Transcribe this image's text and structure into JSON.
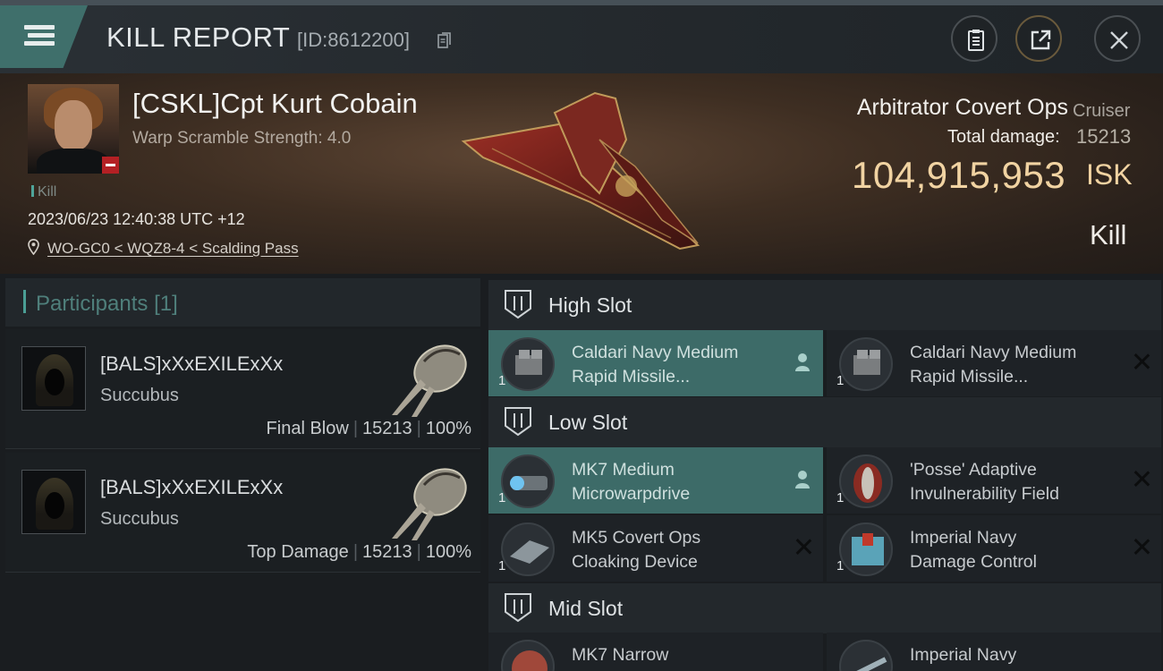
{
  "header": {
    "title": "KILL REPORT",
    "report_id": "[ID:8612200]"
  },
  "victim": {
    "name": "[CSKL]Cpt Kurt Cobain",
    "warp_scramble": "Warp Scramble Strength: 4.0",
    "kill_tag": "Kill",
    "datetime": "2023/06/23 12:40:38 UTC +12",
    "location": "WO-GC0 < WQZ8-4 < Scalding Pass"
  },
  "ship": {
    "name": "Arbitrator Covert Ops",
    "class": "Cruiser",
    "damage_label": "Total damage:",
    "damage_value": "15213",
    "isk_value": "104,915,953",
    "isk_unit": "ISK",
    "result": "Kill"
  },
  "participants": {
    "title": "Participants",
    "count": "[1]",
    "cards": [
      {
        "name": "[BALS]xXxEXILExXx",
        "ship": "Succubus",
        "role": "Final Blow",
        "damage": "15213",
        "percent": "100%"
      },
      {
        "name": "[BALS]xXxEXILExXx",
        "ship": "Succubus",
        "role": "Top Damage",
        "damage": "15213",
        "percent": "100%"
      }
    ]
  },
  "slots": {
    "high": {
      "label": "High Slot",
      "items": [
        {
          "line1": "Caldari Navy Medium",
          "line2": "Rapid Missile...",
          "qty": "1",
          "status": "user"
        },
        {
          "line1": "Caldari Navy Medium",
          "line2": "Rapid Missile...",
          "qty": "1",
          "status": "destroyed"
        }
      ]
    },
    "low": {
      "label": "Low Slot",
      "items": [
        {
          "line1": "MK7 Medium",
          "line2": "Microwarpdrive",
          "qty": "1",
          "status": "user"
        },
        {
          "line1": "'Posse' Adaptive",
          "line2": "Invulnerability Field",
          "qty": "1",
          "status": "destroyed"
        },
        {
          "line1": "MK5 Covert Ops",
          "line2": "Cloaking Device",
          "qty": "1",
          "status": "destroyed"
        },
        {
          "line1": "Imperial Navy",
          "line2": "Damage Control",
          "qty": "1",
          "status": "destroyed"
        }
      ]
    },
    "mid": {
      "label": "Mid Slot",
      "items": [
        {
          "line1": "MK7 Narrow",
          "line2": "",
          "qty": "1",
          "status": "destroyed"
        },
        {
          "line1": "Imperial Navy",
          "line2": "",
          "qty": "1",
          "status": "destroyed"
        }
      ]
    }
  },
  "colors": {
    "accent_teal": "#3d6b68",
    "isk_gold": "#f1d3a2",
    "badge_red": "#b42024"
  },
  "icons": [
    "menu-icon",
    "copy-icon",
    "clipboard-icon",
    "share-icon",
    "close-icon",
    "location-pin-icon",
    "slot-icon",
    "user-icon",
    "x-icon"
  ]
}
